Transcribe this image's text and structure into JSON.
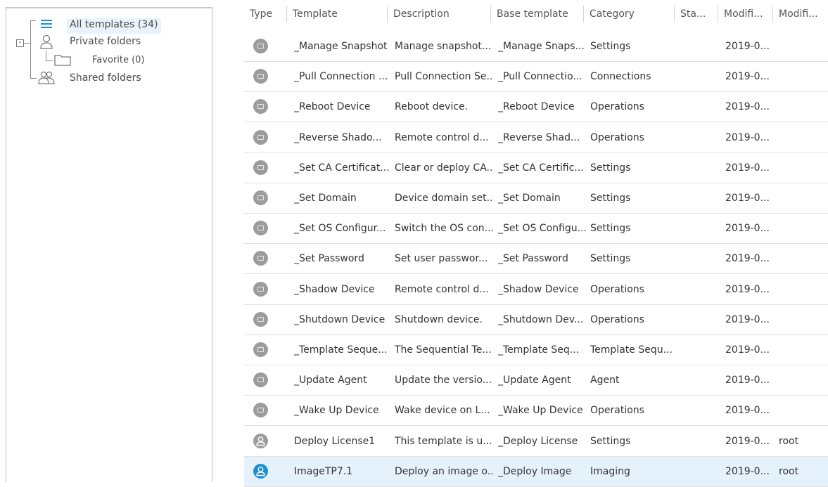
{
  "tree": {
    "items": [
      {
        "label": "All templates (34)",
        "icon": "list-icon",
        "selected": true
      },
      {
        "label": "Private folders",
        "icon": "user-icon"
      },
      {
        "label": "Favorite (0)",
        "icon": "folder-icon"
      },
      {
        "label": "Shared folders",
        "icon": "users-icon"
      }
    ],
    "expander": "-"
  },
  "table": {
    "columns": [
      "Type",
      "Template",
      "Description",
      "Base template",
      "Category",
      "Sta...",
      "Modifi...",
      "Modifi..."
    ],
    "rows": [
      {
        "type": "task-icon",
        "template": "_Manage Snapshot",
        "description": "Manage snapshot...",
        "base": "_Manage Snaps...",
        "category": "Settings",
        "status": "",
        "modified": "2019-0...",
        "modified_by": ""
      },
      {
        "type": "task-icon",
        "template": "_Pull Connection ...",
        "description": "Pull Connection Se...",
        "base": "_Pull Connectio...",
        "category": "Connections",
        "status": "",
        "modified": "2019-0...",
        "modified_by": ""
      },
      {
        "type": "task-icon",
        "template": "_Reboot Device",
        "description": "Reboot device.",
        "base": "_Reboot Device",
        "category": "Operations",
        "status": "",
        "modified": "2019-0...",
        "modified_by": ""
      },
      {
        "type": "task-icon",
        "template": "_Reverse Shado...",
        "description": "Remote control d...",
        "base": "_Reverse Shad...",
        "category": "Operations",
        "status": "",
        "modified": "2019-0...",
        "modified_by": ""
      },
      {
        "type": "task-icon",
        "template": "_Set CA Certificat...",
        "description": "Clear or deploy CA...",
        "base": "_Set CA Certific...",
        "category": "Settings",
        "status": "",
        "modified": "2019-0...",
        "modified_by": ""
      },
      {
        "type": "task-icon",
        "template": "_Set Domain",
        "description": "Device domain set...",
        "base": "_Set Domain",
        "category": "Settings",
        "status": "",
        "modified": "2019-0...",
        "modified_by": ""
      },
      {
        "type": "task-icon",
        "template": "_Set OS Configur...",
        "description": "Switch the OS con...",
        "base": "_Set OS Configu...",
        "category": "Settings",
        "status": "",
        "modified": "2019-0...",
        "modified_by": ""
      },
      {
        "type": "task-icon",
        "template": "_Set Password",
        "description": "Set user passwor...",
        "base": "_Set Password",
        "category": "Settings",
        "status": "",
        "modified": "2019-0...",
        "modified_by": ""
      },
      {
        "type": "task-icon",
        "template": "_Shadow Device",
        "description": "Remote control d...",
        "base": "_Shadow Device",
        "category": "Operations",
        "status": "",
        "modified": "2019-0...",
        "modified_by": ""
      },
      {
        "type": "task-icon",
        "template": "_Shutdown Device",
        "description": "Shutdown device.",
        "base": "_Shutdown Dev...",
        "category": "Operations",
        "status": "",
        "modified": "2019-0...",
        "modified_by": ""
      },
      {
        "type": "task-icon",
        "template": "_Template Seque...",
        "description": "The Sequential Te...",
        "base": "_Template Seq...",
        "category": "Template Sequ...",
        "status": "",
        "modified": "2019-0...",
        "modified_by": ""
      },
      {
        "type": "task-icon",
        "template": "_Update Agent",
        "description": "Update the versio...",
        "base": "_Update Agent",
        "category": "Agent",
        "status": "",
        "modified": "2019-0...",
        "modified_by": ""
      },
      {
        "type": "task-icon",
        "template": "_Wake Up Device",
        "description": "Wake device on L...",
        "base": "_Wake Up Device",
        "category": "Operations",
        "status": "",
        "modified": "2019-0...",
        "modified_by": ""
      },
      {
        "type": "user-template-icon",
        "template": "Deploy License1",
        "description": "This template is u...",
        "base": "_Deploy License",
        "category": "Settings",
        "status": "",
        "modified": "2019-0...",
        "modified_by": "root"
      },
      {
        "type": "user-template-icon",
        "template": "ImageTP7.1",
        "description": "Deploy an image o...",
        "base": "_Deploy Image",
        "category": "Imaging",
        "status": "",
        "modified": "2019-0...",
        "modified_by": "root",
        "selected": true
      }
    ]
  },
  "colors": {
    "selection": "#e6f2fb",
    "accent": "#1f8fd6",
    "icon_gray": "#9c9c9c"
  }
}
